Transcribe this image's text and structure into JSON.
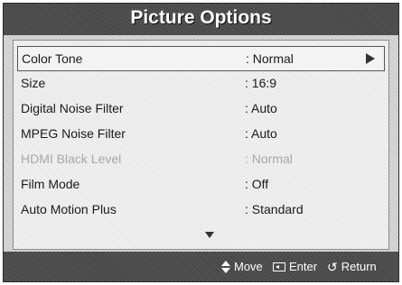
{
  "title": "Picture Options",
  "menu": {
    "items": [
      {
        "label": "Color Tone",
        "value": ": Normal",
        "selected": true,
        "disabled": false
      },
      {
        "label": "Size",
        "value": ": 16:9",
        "selected": false,
        "disabled": false
      },
      {
        "label": "Digital Noise Filter",
        "value": ": Auto",
        "selected": false,
        "disabled": false
      },
      {
        "label": "MPEG Noise Filter",
        "value": ": Auto",
        "selected": false,
        "disabled": false
      },
      {
        "label": "HDMI Black Level",
        "value": ": Normal",
        "selected": false,
        "disabled": true
      },
      {
        "label": "Film Mode",
        "value": ": Off",
        "selected": false,
        "disabled": false
      },
      {
        "label": "Auto Motion Plus",
        "value": ": Standard",
        "selected": false,
        "disabled": false
      }
    ]
  },
  "footer": {
    "move_label": "Move",
    "enter_label": "Enter",
    "return_label": "Return",
    "return_icon": "↺"
  },
  "icons": {
    "selected_arrow": "right-arrow-icon",
    "scroll": "scroll-down-icon",
    "move": "up-down-arrow-icon",
    "enter": "enter-icon",
    "return": "return-icon"
  }
}
